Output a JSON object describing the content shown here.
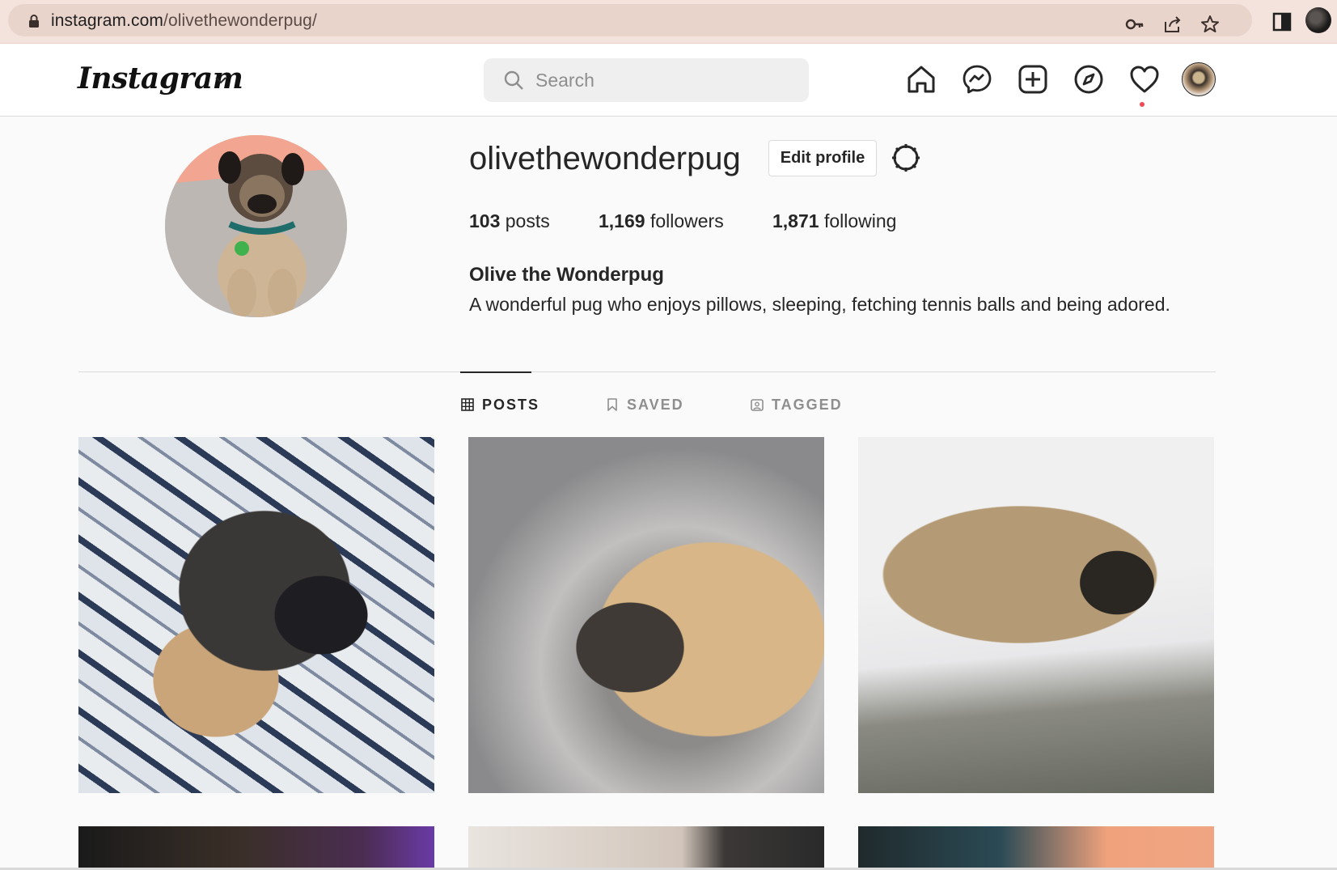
{
  "browser": {
    "url_host": "instagram.com",
    "url_path": "/olivethewonderpug/"
  },
  "header": {
    "logo": "Instagram",
    "search_placeholder": "Search",
    "nav_icons": [
      "home-icon",
      "messenger-icon",
      "new-post-icon",
      "explore-icon",
      "activity-heart-icon",
      "profile-avatar"
    ]
  },
  "profile": {
    "username": "olivethewonderpug",
    "edit_label": "Edit profile",
    "posts_count": "103",
    "posts_label": " posts",
    "followers_count": "1,169",
    "followers_label": " followers",
    "following_count": "1,871",
    "following_label": " following",
    "full_name": "Olive the Wonderpug",
    "bio": "A wonderful pug who enjoys pillows, sleeping, fetching tennis balls and being adored."
  },
  "tabs": [
    {
      "label": "POSTS",
      "active": true
    },
    {
      "label": "SAVED",
      "active": false
    },
    {
      "label": "TAGGED",
      "active": false
    }
  ],
  "colors": {
    "notification": "#ed4956",
    "text": "#262626",
    "muted": "#8e8e8e"
  }
}
